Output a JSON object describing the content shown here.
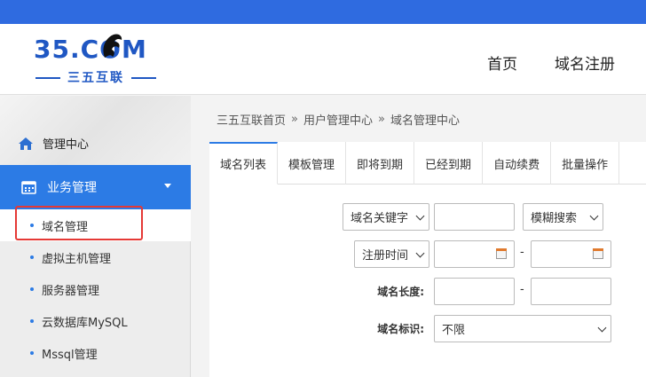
{
  "header": {
    "logo_text": "35.COM",
    "logo_sub": "三五互联",
    "nav": [
      "首页",
      "域名注册"
    ]
  },
  "sidebar": {
    "center_label": "管理中心",
    "section_label": "业务管理",
    "items": [
      {
        "label": "域名管理",
        "active": true
      },
      {
        "label": "虚拟主机管理"
      },
      {
        "label": "服务器管理"
      },
      {
        "label": "云数据库MySQL"
      },
      {
        "label": "Mssql管理"
      }
    ]
  },
  "breadcrumb": [
    "三五互联首页",
    "用户管理中心",
    "域名管理中心"
  ],
  "tabs": [
    "域名列表",
    "模板管理",
    "即将到期",
    "已经到期",
    "自动续费",
    "批量操作"
  ],
  "filters": {
    "keyword_select": "域名关键字",
    "match_select": "模糊搜索",
    "date_select": "注册时间",
    "date_separator": "-",
    "length_label": "域名长度:",
    "length_separator": "-",
    "mark_label": "域名标识:",
    "mark_select": "不限"
  },
  "colors": {
    "topbar": "#2f6be0",
    "accent": "#2c7be5",
    "highlight": "#e53935"
  }
}
